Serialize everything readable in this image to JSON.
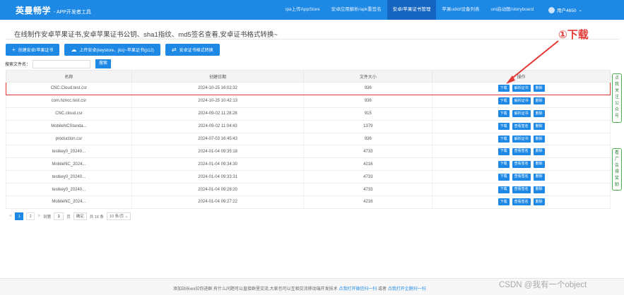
{
  "brand": {
    "title": "英曼畅学",
    "subtitle": "- APP开发者工具"
  },
  "nav": {
    "links": [
      "ipa上传AppStore",
      "安卓应用解析/apk重签名",
      "安卓/苹果证书管理",
      "苹果udid/设备列表",
      "uni启动图/storyboard"
    ],
    "active_index": 2,
    "user": "用户4650"
  },
  "page": {
    "title": "在线制作安卓苹果证书,安卓苹果证书公钥、sha1指纹、md5签名查看,安卓证书格式转换~"
  },
  "actions": [
    {
      "icon": "plus-icon",
      "glyph": "+",
      "label": "创建安卓/苹果证书"
    },
    {
      "icon": "cloud-upload-icon",
      "glyph": "☁",
      "label": "上传安卓(keystore、jks)~苹果证书(p12)"
    },
    {
      "icon": "convert-icon",
      "glyph": "⇄",
      "label": "安卓证书格式转换"
    }
  ],
  "search": {
    "label": "搜索文件名：",
    "value": "",
    "placeholder": "",
    "button": "搜索"
  },
  "table": {
    "headers": [
      "名称",
      "创建日期",
      "文件大小",
      "操作"
    ],
    "rows": [
      {
        "name": "CNC.Cloud.test.csr",
        "date": "2024-10-25 16:02:32",
        "size": "936",
        "actions": [
          "下载",
          "解析证书",
          "删除"
        ]
      },
      {
        "name": "com.hzncc.test.csr",
        "date": "2024-10-25 10:42:13",
        "size": "936",
        "actions": [
          "下载",
          "解析证书",
          "删除"
        ]
      },
      {
        "name": "CNC.cloud.csr",
        "date": "2024-09-02 11:28:28",
        "size": "915",
        "actions": [
          "下载",
          "解析证书",
          "删除"
        ]
      },
      {
        "name": "MobileNCStanda...",
        "date": "2024-09-02 11:04:43",
        "size": "1379",
        "actions": [
          "下载",
          "查看签名",
          "删除"
        ]
      },
      {
        "name": "production.csr",
        "date": "2024-07-03 16:45:43",
        "size": "936",
        "actions": [
          "下载",
          "解析证书",
          "删除"
        ]
      },
      {
        "name": "testkey0_20240...",
        "date": "2024-01-04 09:35:18",
        "size": "4733",
        "actions": [
          "下载",
          "查看签名",
          "删除"
        ]
      },
      {
        "name": "MobileNC_2024...",
        "date": "2024-01-04 09:34:30",
        "size": "4216",
        "actions": [
          "下载",
          "查看签名",
          "删除"
        ]
      },
      {
        "name": "testkey0_20240...",
        "date": "2024-01-04 09:33:31",
        "size": "4733",
        "actions": [
          "下载",
          "查看签名",
          "删除"
        ]
      },
      {
        "name": "testkey0_20240...",
        "date": "2024-01-04 09:28:20",
        "size": "4733",
        "actions": [
          "下载",
          "查看签名",
          "删除"
        ]
      },
      {
        "name": "MobileNC_2024...",
        "date": "2024-01-04 09:27:22",
        "size": "4216",
        "actions": [
          "下载",
          "查看签名",
          "删除"
        ]
      }
    ]
  },
  "pagination": {
    "prev": "<",
    "pages": [
      "1",
      "2"
    ],
    "current": "1",
    "next": ">",
    "goto_label": "到第",
    "goto_value": "1",
    "page_unit": "页",
    "go": "确定",
    "total": "共 16 条",
    "page_size": "10 条/页"
  },
  "side_tabs": [
    {
      "text": "点我关注公众号"
    },
    {
      "text": "看广告得奖励"
    }
  ],
  "footer": {
    "text": "添加站长wx拉你进群,有什么问题可以直接群里交流,大家也可以互相交流移动端开发技术",
    "link1": "点我打开微信扫一扫",
    "sep": "或者",
    "link2": "点我打开企鹅扫一扫"
  },
  "watermark": "CSDN @我有一个object",
  "annotation": {
    "label": "①下载"
  },
  "colors": {
    "primary": "#1e88e5",
    "highlight": "#e53935",
    "side_tab_border": "#4caf50"
  }
}
